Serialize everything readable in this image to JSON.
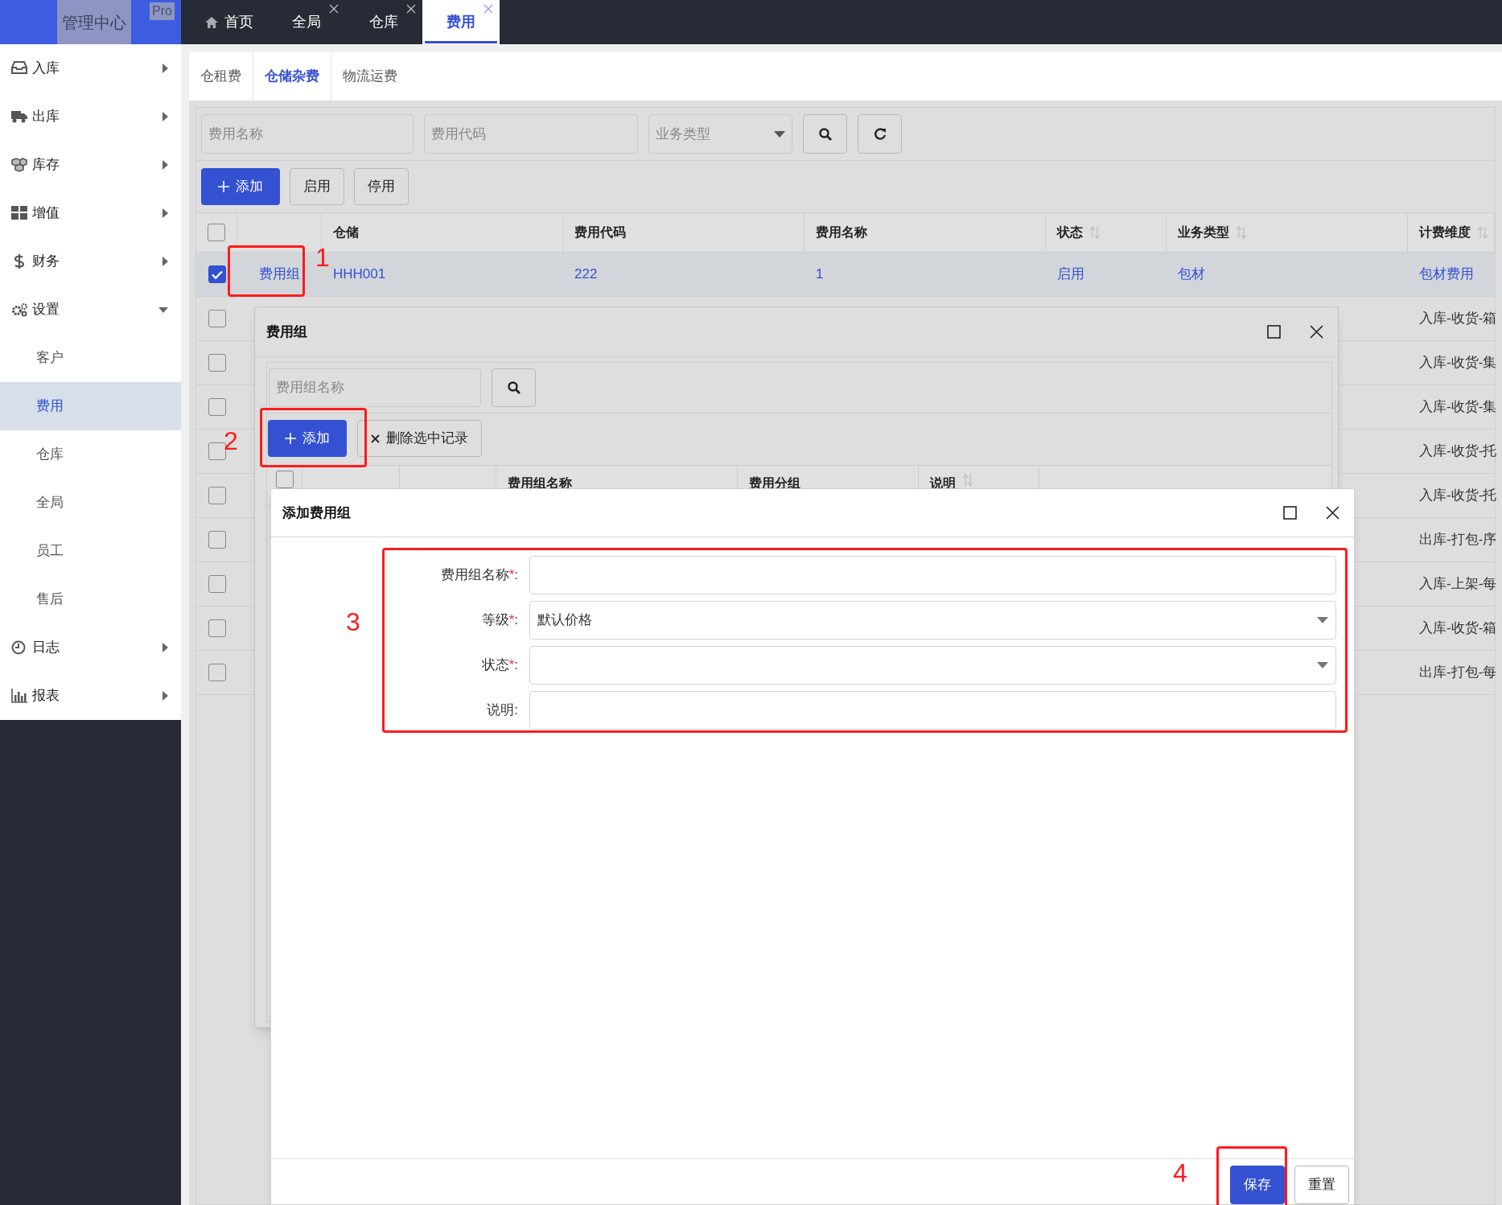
{
  "header": {
    "logo": "管理中心",
    "badge": "Pro"
  },
  "tabs": [
    {
      "label": "首页",
      "kind": "home",
      "closable": false,
      "selected": false
    },
    {
      "label": "全局",
      "kind": "page",
      "closable": true,
      "selected": false
    },
    {
      "label": "仓库",
      "kind": "page",
      "closable": true,
      "selected": false
    },
    {
      "label": "费用",
      "kind": "page",
      "closable": true,
      "selected": true
    }
  ],
  "sidebar": {
    "items": [
      {
        "label": "入库",
        "expanded": false
      },
      {
        "label": "出库",
        "expanded": false
      },
      {
        "label": "库存",
        "expanded": false
      },
      {
        "label": "增值",
        "expanded": false
      },
      {
        "label": "财务",
        "expanded": false
      },
      {
        "label": "设置",
        "expanded": true,
        "children": [
          {
            "label": "客户",
            "selected": false
          },
          {
            "label": "费用",
            "selected": true
          },
          {
            "label": "仓库",
            "selected": false
          },
          {
            "label": "全局",
            "selected": false
          },
          {
            "label": "员工",
            "selected": false
          },
          {
            "label": "售后",
            "selected": false
          }
        ]
      },
      {
        "label": "日志",
        "expanded": false
      },
      {
        "label": "报表",
        "expanded": false
      }
    ]
  },
  "subtabs": [
    {
      "label": "仓租费",
      "selected": false
    },
    {
      "label": "仓储杂费",
      "selected": true
    },
    {
      "label": "物流运费",
      "selected": false
    }
  ],
  "filters": [
    {
      "kind": "text",
      "placeholder": "费用名称"
    },
    {
      "kind": "text",
      "placeholder": "费用代码"
    },
    {
      "kind": "select",
      "placeholder": "业务类型"
    }
  ],
  "toolbar": [
    {
      "label": "添加",
      "kind": "primary"
    },
    {
      "label": "启用",
      "kind": "default"
    },
    {
      "label": "停用",
      "kind": "default"
    }
  ],
  "table": {
    "all_selected": false,
    "columns": [
      {
        "label": "仓储",
        "sortable": false
      },
      {
        "label": "费用代码",
        "sortable": false
      },
      {
        "label": "费用名称",
        "sortable": false
      },
      {
        "label": "状态",
        "sortable": true
      },
      {
        "label": "业务类型",
        "sortable": true
      },
      {
        "label": "计费维度",
        "sortable": true
      }
    ],
    "rows": [
      {
        "selected": true,
        "link": "费用组",
        "warehouse": "HHH001",
        "fee_code": "222",
        "fee_name": "1",
        "status": "启用",
        "business_type": "包材",
        "billing_dimension": "包材费用"
      },
      {
        "selected": false,
        "billing_dimension": "入库-收货-箱"
      },
      {
        "selected": false,
        "billing_dimension": "入库-收货-集"
      },
      {
        "selected": false,
        "billing_dimension": "入库-收货-集"
      },
      {
        "selected": false,
        "billing_dimension": "入库-收货-托"
      },
      {
        "selected": false,
        "billing_dimension": "入库-收货-托"
      },
      {
        "selected": false,
        "billing_dimension": "出库-打包-序"
      },
      {
        "selected": false,
        "billing_dimension": "入库-上架-每"
      },
      {
        "selected": false,
        "billing_dimension": "入库-收货-箱"
      },
      {
        "selected": false,
        "billing_dimension": "出库-打包-每"
      }
    ]
  },
  "fee_group_dialog": {
    "title": "费用组",
    "search_placeholder": "费用组名称",
    "buttons": [
      {
        "label": "添加",
        "kind": "primary"
      },
      {
        "label": "删除选中记录",
        "kind": "delete"
      }
    ],
    "all_selected": false,
    "columns": [
      {
        "label": "费用组名称",
        "sortable": false
      },
      {
        "label": "费用分组",
        "sortable": false
      },
      {
        "label": "说明",
        "sortable": true
      }
    ]
  },
  "add_fee_group_dialog": {
    "title": "添加费用组",
    "fields": [
      {
        "label": "费用组名称",
        "asterisk": "*",
        "colon": ":",
        "kind": "text"
      },
      {
        "label": "等级",
        "asterisk": "*",
        "colon": ":",
        "kind": "select",
        "value": "默认价格"
      },
      {
        "label": "状态",
        "asterisk": "*",
        "colon": ":",
        "kind": "select"
      },
      {
        "label": "说明",
        "colon": ":",
        "kind": "text"
      }
    ],
    "buttons": [
      {
        "label": "保存",
        "kind": "primary"
      },
      {
        "label": "重置",
        "kind": "default"
      }
    ]
  },
  "annotations": [
    "1",
    "2",
    "3",
    "4"
  ]
}
